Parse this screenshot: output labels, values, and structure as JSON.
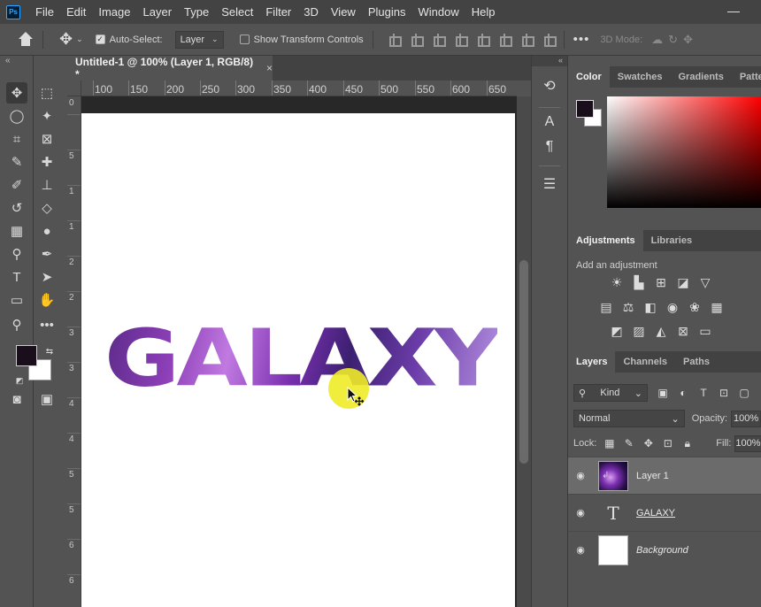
{
  "menubar": {
    "logo": "Ps",
    "items": [
      "File",
      "Edit",
      "Image",
      "Layer",
      "Type",
      "Select",
      "Filter",
      "3D",
      "View",
      "Plugins",
      "Window",
      "Help"
    ]
  },
  "options": {
    "auto_select_label": "Auto-Select:",
    "auto_select_value": "Layer",
    "show_transform_label": "Show Transform Controls",
    "three_d_label": "3D Mode:",
    "more": "•••"
  },
  "document": {
    "tab_title": "Untitled-1 @ 100% (Layer 1, RGB/8) *",
    "tab_close": "×",
    "ruler_labels": [
      "100",
      "150",
      "200",
      "250",
      "300",
      "350",
      "400",
      "450",
      "500",
      "550",
      "600",
      "650"
    ],
    "vruler_labels": [
      "0",
      "5",
      "1",
      "1",
      "2",
      "2",
      "3",
      "3",
      "4",
      "4",
      "5",
      "5",
      "6",
      "6"
    ],
    "canvas_text": "GALAXY"
  },
  "panels": {
    "color_tabs": [
      "Color",
      "Swatches",
      "Gradients",
      "Patterns"
    ],
    "adjust_tabs": [
      "Adjustments",
      "Libraries"
    ],
    "adjust_title": "Add an adjustment",
    "layers_tabs": [
      "Layers",
      "Channels",
      "Paths"
    ],
    "kind_label": "Kind",
    "blend_mode": "Normal",
    "opacity_label": "Opacity:",
    "opacity_value": "100%",
    "lock_label": "Lock:",
    "fill_label": "Fill:",
    "fill_value": "100%"
  },
  "layers": [
    {
      "name": "Layer 1",
      "type": "image",
      "selected": true
    },
    {
      "name": "GALAXY",
      "type": "text",
      "selected": false
    },
    {
      "name": "Background",
      "type": "background",
      "selected": false
    }
  ],
  "colors": {
    "foreground": "#1a0d1c",
    "background": "#ffffff",
    "accent_highlight": "#f0eb28"
  }
}
